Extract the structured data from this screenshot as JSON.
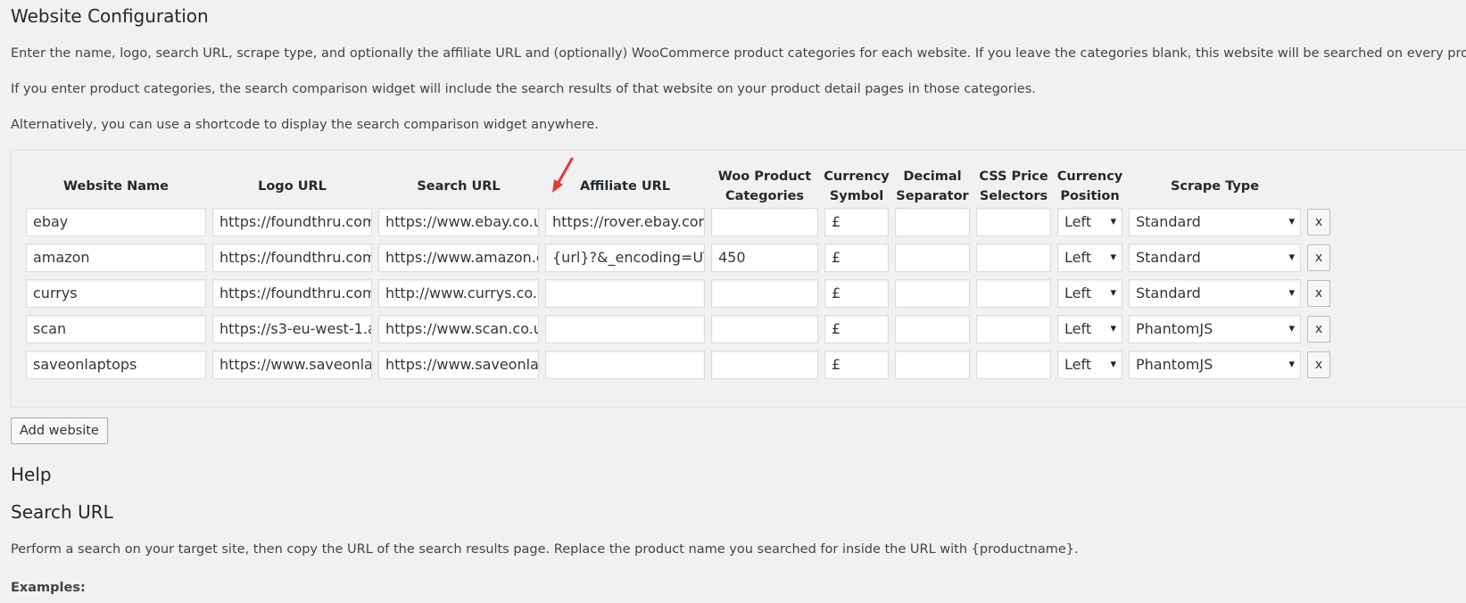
{
  "page": {
    "title": "Website Configuration",
    "intro": [
      "Enter the name, logo, search URL, scrape type, and optionally the affiliate URL and (optionally) WooCommerce product categories for each website. If you leave the categories blank, this website will be searched on every product",
      "If you enter product categories, the search comparison widget will include the search results of that website on your product detail pages in those categories.",
      "Alternatively, you can use a shortcode to display the search comparison widget anywhere."
    ]
  },
  "table": {
    "headers": [
      "Website Name",
      "Logo URL",
      "Search URL",
      "Affiliate URL",
      "Woo Product Categories",
      "Currency Symbol",
      "Decimal Separator",
      "CSS Price Selectors",
      "Currency Position",
      "Scrape Type"
    ],
    "rows": [
      {
        "name": "ebay",
        "logo": "https://foundthru.com",
        "search": "https://www.ebay.co.u",
        "affiliate": "https://rover.ebay.com",
        "categories": "",
        "currency": "£",
        "decimal": "",
        "css": "",
        "position": "Left",
        "scrape": "Standard"
      },
      {
        "name": "amazon",
        "logo": "https://foundthru.com",
        "search": "https://www.amazon.c",
        "affiliate": "{url}?&_encoding=UTF",
        "categories": "450",
        "currency": "£",
        "decimal": "",
        "css": "",
        "position": "Left",
        "scrape": "Standard"
      },
      {
        "name": "currys",
        "logo": "https://foundthru.com",
        "search": "http://www.currys.co.u",
        "affiliate": "",
        "categories": "",
        "currency": "£",
        "decimal": "",
        "css": "",
        "position": "Left",
        "scrape": "Standard"
      },
      {
        "name": "scan",
        "logo": "https://s3-eu-west-1.a",
        "search": "https://www.scan.co.ul",
        "affiliate": "",
        "categories": "",
        "currency": "£",
        "decimal": "",
        "css": "",
        "position": "Left",
        "scrape": "PhantomJS"
      },
      {
        "name": "saveonlaptops",
        "logo": "https://www.saveonlap",
        "search": "https://www.saveonlap",
        "affiliate": "",
        "categories": "",
        "currency": "£",
        "decimal": "",
        "css": "",
        "position": "Left",
        "scrape": "PhantomJS"
      }
    ],
    "remove_label": "x"
  },
  "add_button": "Add website",
  "help": {
    "title": "Help",
    "search_url_title": "Search URL",
    "search_url_text": "Perform a search on your target site, then copy the URL of the search results page. Replace the product name you searched for inside the URL with {productname}.",
    "examples_label": "Examples:"
  },
  "annotation": {
    "arrow_color": "#e53935"
  }
}
